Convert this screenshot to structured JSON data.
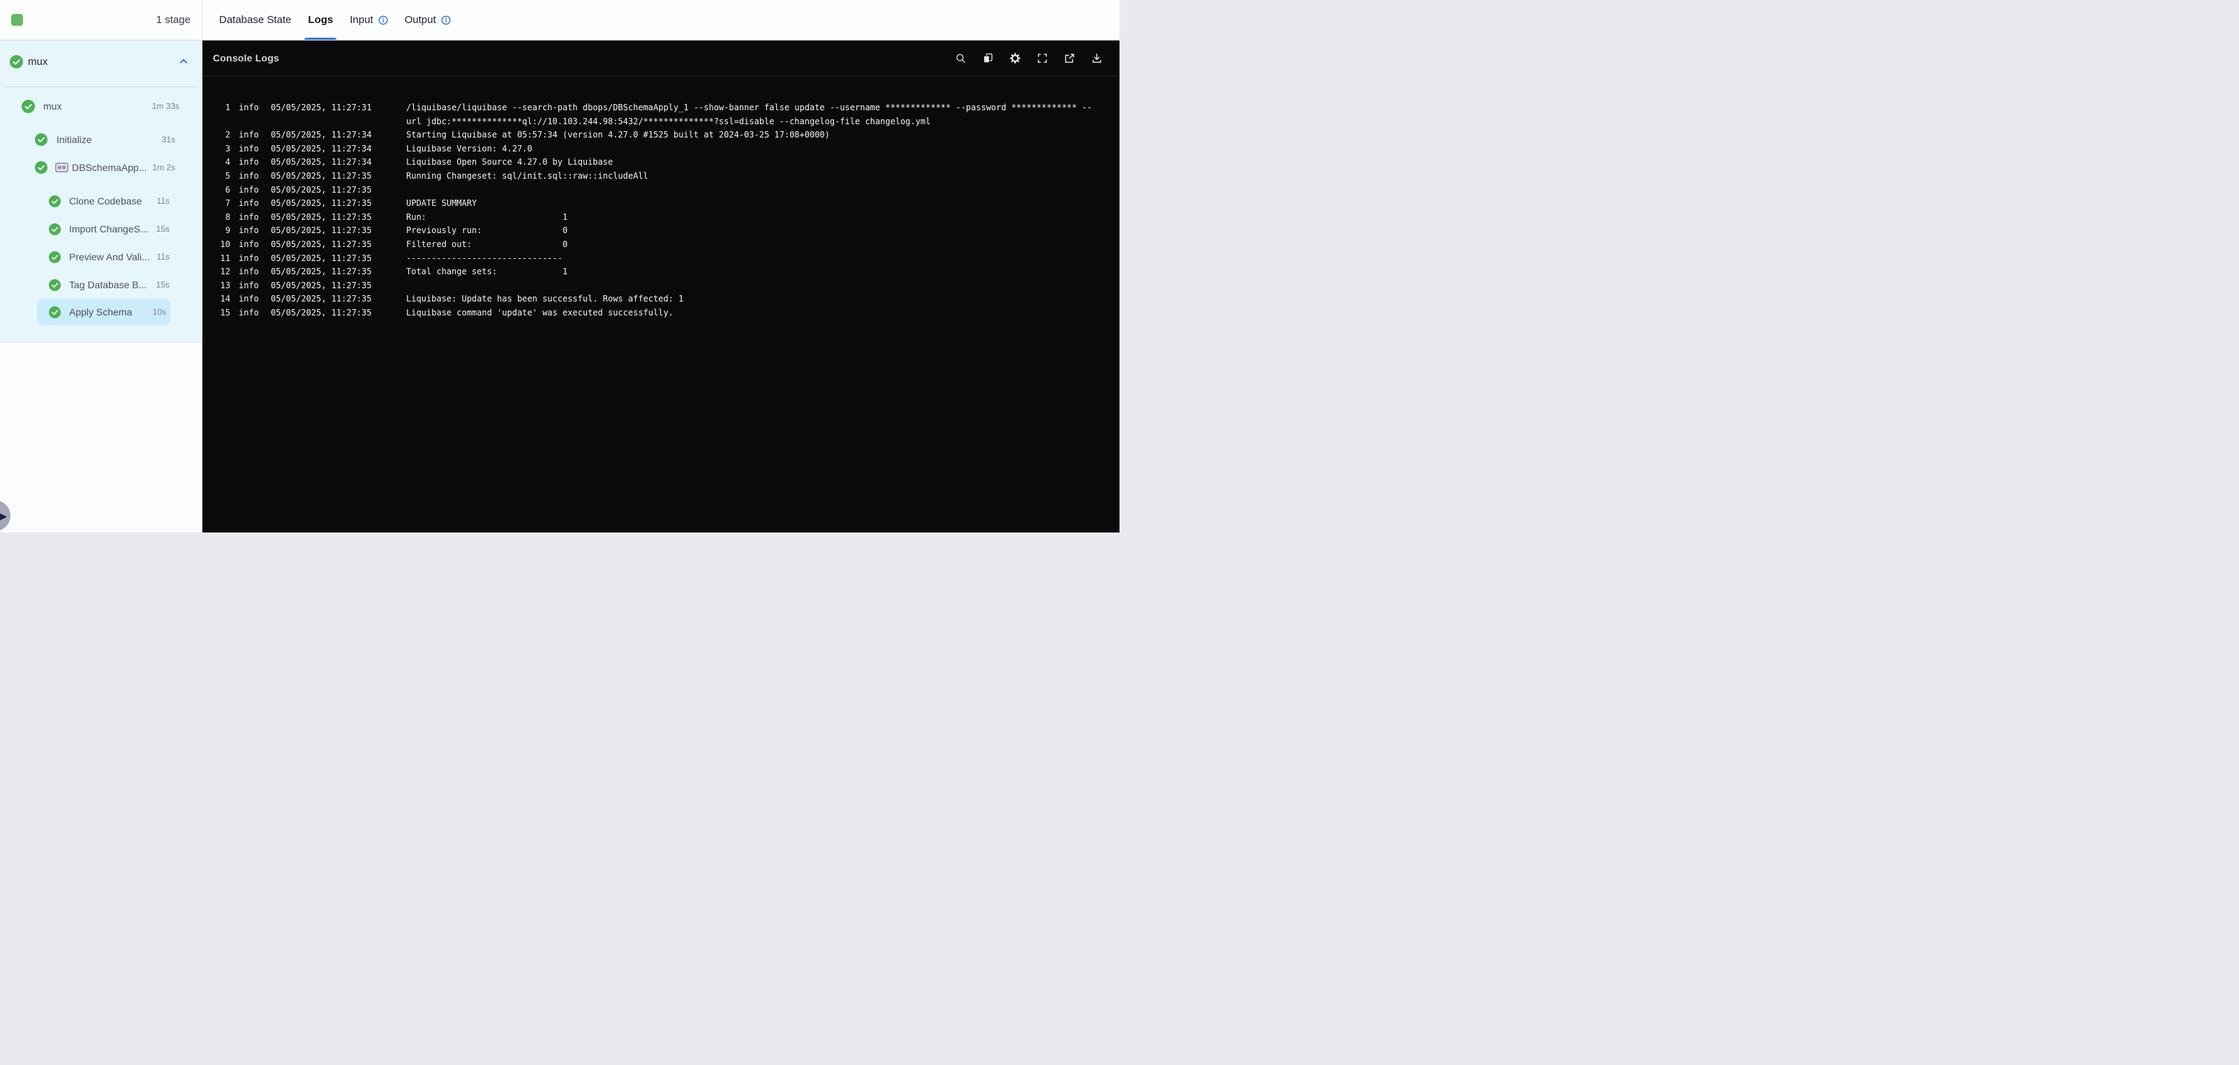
{
  "colors": {
    "accent_blue": "#2b6cd9",
    "tab_underline": "#3a76dc",
    "success_green": "#4bb153",
    "stage_square_green": "#62bb64",
    "sidebar_bg": "#e7f6fb",
    "selected_item_bg": "#cbecfa",
    "console_bg": "#0a0a0c",
    "log_text": "#f4f4f6"
  },
  "sidebar": {
    "stage_count_label": "1 stage",
    "stage_header": {
      "label": "mux",
      "status": "success",
      "collapse_icon": "chevron-up-icon"
    },
    "tree": [
      {
        "label": "mux",
        "duration": "1m 33s",
        "level": 0,
        "status": "success"
      },
      {
        "label": "Initialize",
        "duration": "31s",
        "level": 1,
        "status": "success"
      },
      {
        "label": "DBSchemaApp...",
        "duration": "1m 2s",
        "level": 1,
        "status": "success",
        "group_icon": "step-group-icon"
      },
      {
        "label": "Clone Codebase",
        "duration": "11s",
        "level": 2,
        "status": "success",
        "gap_top": true
      },
      {
        "label": "Import ChangeS...",
        "duration": "15s",
        "level": 2,
        "status": "success"
      },
      {
        "label": "Preview And Vali...",
        "duration": "11s",
        "level": 2,
        "status": "success"
      },
      {
        "label": "Tag Database B...",
        "duration": "15s",
        "level": 2,
        "status": "success"
      },
      {
        "label": "Apply Schema",
        "duration": "10s",
        "level": 2,
        "status": "success",
        "selected": true
      }
    ],
    "expand_button_icon": "play-triangle-icon"
  },
  "tabs": [
    {
      "label": "Database State"
    },
    {
      "label": "Logs",
      "active": true
    },
    {
      "label": "Input",
      "info_icon": true
    },
    {
      "label": "Output",
      "info_icon": true
    }
  ],
  "console": {
    "title": "Console Logs",
    "toolbar_icons": [
      "search-icon",
      "copy-icon",
      "settings-icon",
      "fullscreen-icon",
      "open-in-new-icon",
      "download-icon"
    ],
    "logs": [
      {
        "n": "1",
        "level": "info",
        "time": "05/05/2025, 11:27:31",
        "lines": [
          "/liquibase/liquibase --search-path dbops/DBSchemaApply_1 --show-banner false update --username ************* --password ************* --",
          "url jdbc:**************ql://10.103.244.98:5432/**************?ssl=disable --changelog-file changelog.yml"
        ]
      },
      {
        "n": "2",
        "level": "info",
        "time": "05/05/2025, 11:27:34",
        "lines": [
          "Starting Liquibase at 05:57:34 (version 4.27.0 #1525 built at 2024-03-25 17:08+0000)"
        ]
      },
      {
        "n": "3",
        "level": "info",
        "time": "05/05/2025, 11:27:34",
        "lines": [
          "Liquibase Version: 4.27.0"
        ]
      },
      {
        "n": "4",
        "level": "info",
        "time": "05/05/2025, 11:27:34",
        "lines": [
          "Liquibase Open Source 4.27.0 by Liquibase"
        ]
      },
      {
        "n": "5",
        "level": "info",
        "time": "05/05/2025, 11:27:35",
        "lines": [
          "Running Changeset: sql/init.sql::raw::includeAll"
        ]
      },
      {
        "n": "6",
        "level": "info",
        "time": "05/05/2025, 11:27:35",
        "lines": [
          ""
        ]
      },
      {
        "n": "7",
        "level": "info",
        "time": "05/05/2025, 11:27:35",
        "lines": [
          "UPDATE SUMMARY"
        ]
      },
      {
        "n": "8",
        "level": "info",
        "time": "05/05/2025, 11:27:35",
        "lines": [
          "Run:                           1"
        ]
      },
      {
        "n": "9",
        "level": "info",
        "time": "05/05/2025, 11:27:35",
        "lines": [
          "Previously run:                0"
        ]
      },
      {
        "n": "10",
        "level": "info",
        "time": "05/05/2025, 11:27:35",
        "lines": [
          "Filtered out:                  0"
        ]
      },
      {
        "n": "11",
        "level": "info",
        "time": "05/05/2025, 11:27:35",
        "lines": [
          "-------------------------------"
        ]
      },
      {
        "n": "12",
        "level": "info",
        "time": "05/05/2025, 11:27:35",
        "lines": [
          "Total change sets:             1"
        ]
      },
      {
        "n": "13",
        "level": "info",
        "time": "05/05/2025, 11:27:35",
        "lines": [
          ""
        ]
      },
      {
        "n": "14",
        "level": "info",
        "time": "05/05/2025, 11:27:35",
        "lines": [
          "Liquibase: Update has been successful. Rows affected: 1"
        ]
      },
      {
        "n": "15",
        "level": "info",
        "time": "05/05/2025, 11:27:35",
        "lines": [
          "Liquibase command 'update' was executed successfully."
        ]
      }
    ]
  }
}
